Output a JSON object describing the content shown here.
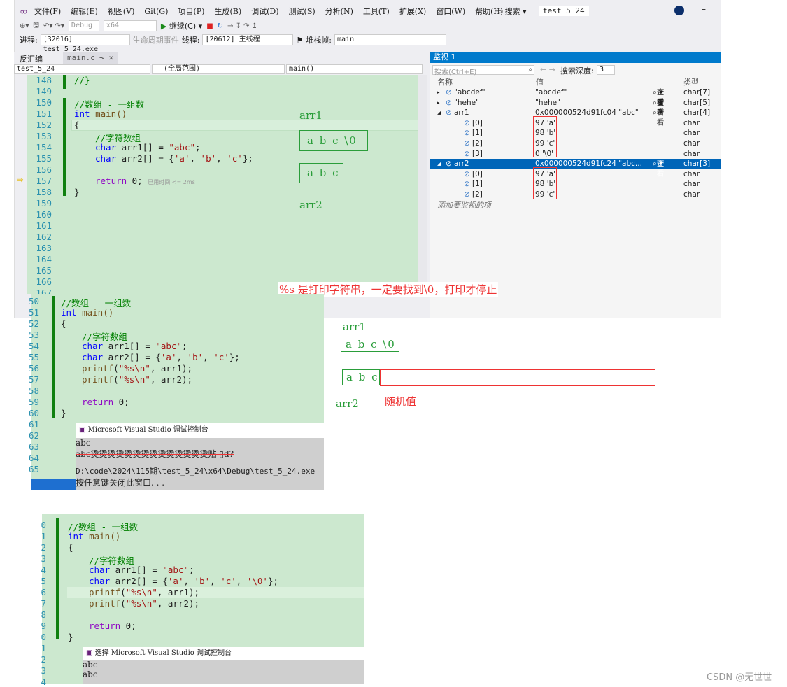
{
  "menu": [
    "文件(F)",
    "编辑(E)",
    "视图(V)",
    "Git(G)",
    "项目(P)",
    "生成(B)",
    "调试(D)",
    "测试(S)",
    "分析(N)",
    "工具(T)",
    "扩展(X)",
    "窗口(W)",
    "帮助(H)"
  ],
  "search_label": "搜索",
  "solution_title": "test_5_24",
  "toolbar": {
    "config": "Debug",
    "platform": "x64",
    "continue": "继续(C)"
  },
  "procbar": {
    "process_label": "进程:",
    "process": "[32016] test_5_24.exe",
    "lifecycle": "生命周期事件",
    "thread_label": "线程:",
    "thread": "[20612] 主线程",
    "stack_label": "堆栈帧:",
    "stack": "main"
  },
  "tabs": [
    {
      "label": "反汇编"
    },
    {
      "label": "main.c"
    }
  ],
  "navbar": {
    "project": "test_5_24",
    "scope": "(全局范围)",
    "func": "main()"
  },
  "editor1": {
    "lines": [
      "148",
      "149",
      "150",
      "151",
      "152",
      "153",
      "154",
      "155",
      "156",
      "157",
      "158",
      "159",
      "160",
      "161",
      "162",
      "163",
      "164",
      "165",
      "166",
      "167"
    ],
    "elapsed": "已用时间 <= 2ms"
  },
  "watch": {
    "title": "监视 1",
    "search_placeholder": "搜索(Ctrl+E)",
    "depth_label": "搜索深度:",
    "depth": "3",
    "cols": [
      "名称",
      "值",
      "类型"
    ],
    "view": "查看",
    "rows": [
      {
        "name": "\"abcdef\"",
        "value": "\"abcdef\"",
        "type": "char[7]",
        "view": true,
        "level": 0,
        "exp": "▸"
      },
      {
        "name": "\"hehe\"",
        "value": "\"hehe\"",
        "type": "char[5]",
        "view": true,
        "level": 0,
        "exp": "▸"
      },
      {
        "name": "arr1",
        "value": "0x000000524d91fc04 \"abc\"",
        "type": "char[4]",
        "view": true,
        "level": 0,
        "exp": "◢"
      },
      {
        "name": "[0]",
        "value": "97 'a'",
        "type": "char",
        "level": 1
      },
      {
        "name": "[1]",
        "value": "98 'b'",
        "type": "char",
        "level": 1
      },
      {
        "name": "[2]",
        "value": "99 'c'",
        "type": "char",
        "level": 1
      },
      {
        "name": "[3]",
        "value": "0 '\\0'",
        "type": "char",
        "level": 1
      },
      {
        "name": "arr2",
        "value": "0x000000524d91fc24 \"abc...",
        "type": "char[3]",
        "view": true,
        "level": 0,
        "exp": "◢",
        "selected": true
      },
      {
        "name": "[0]",
        "value": "97 'a'",
        "type": "char",
        "level": 1
      },
      {
        "name": "[1]",
        "value": "98 'b'",
        "type": "char",
        "level": 1
      },
      {
        "name": "[2]",
        "value": "99 'c'",
        "type": "char",
        "level": 1
      }
    ],
    "add_item": "添加要监视的项"
  },
  "notes": {
    "arr1": "arr1",
    "arr2": "arr2",
    "box1": "a b c \\0",
    "box2": "a b c",
    "percent_s": "%s 是打印字符串，一定要找到\\0，打印才停止",
    "random": "随机值"
  },
  "editor2": {
    "lines": [
      "50",
      "51",
      "52",
      "53",
      "54",
      "55",
      "56",
      "57",
      "58",
      "59",
      "60",
      "61",
      "62",
      "63",
      "64",
      "65"
    ]
  },
  "console1": {
    "title": "Microsoft Visual Studio 调试控制台",
    "out1": "abc",
    "out2": "abc烫烫烫烫烫烫烫烫烫烫烫烫烫烫贴 ▯d?",
    "path": "D:\\code\\2024\\115期\\test_5_24\\x64\\Debug\\test_5_24.exe",
    "close": "按任意键关闭此窗口. . ."
  },
  "editor3": {
    "lines": [
      "0",
      "1",
      "2",
      "3",
      "4",
      "5",
      "6",
      "7",
      "8",
      "9",
      "0",
      "1",
      "2",
      "3",
      "4"
    ]
  },
  "console2": {
    "title": "选择 Microsoft Visual Studio 调试控制台",
    "out1": "abc",
    "out2": "abc"
  },
  "code": {
    "c150": "//数组 - 一组数",
    "int": "int",
    "main": " main()",
    "lb": "{",
    "c153": "//字符数组",
    "char": "char",
    "arr1": " arr1[] = ",
    "abc": "\"abc\"",
    "semi": ";",
    "arr2": " arr2[] = {",
    "a": "'a'",
    "b": "'b'",
    "c": "'c'",
    "z": "'\\0'",
    "comma": ", ",
    "rb2": "};",
    "ret": "return",
    "zero": " 0;",
    "rb": "}",
    "pf": "printf",
    "pf1a": "(",
    "fmt": "\"%s\\n\"",
    "pf1b": ", arr1);",
    "pf2b": ", arr2);",
    "c148": "//}"
  },
  "watermark": "CSDN @无世世"
}
